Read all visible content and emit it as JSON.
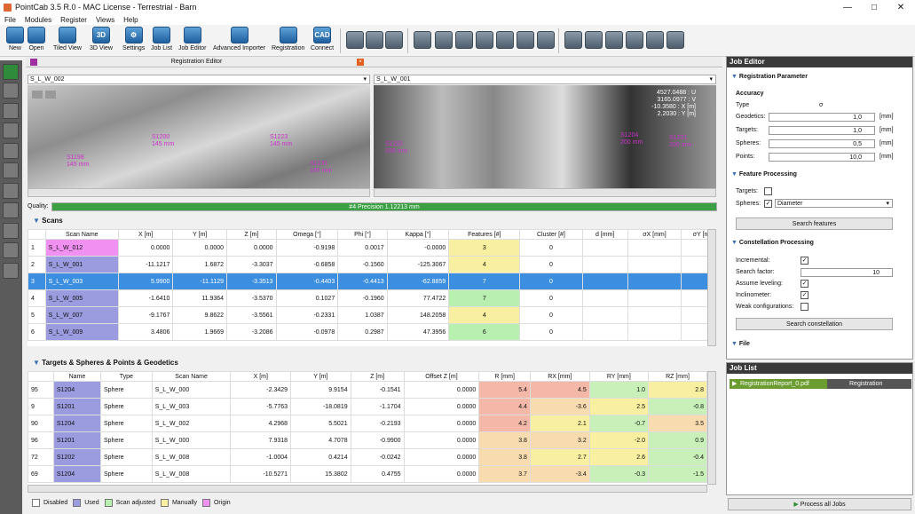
{
  "window": {
    "title": "PointCab 3.5 R.0 - MAC License - Terrestrial - Barn"
  },
  "menu": [
    "File",
    "Modules",
    "Register",
    "Views",
    "Help"
  ],
  "toolbar": {
    "buttons": [
      {
        "label": "New",
        "icon": "new-file-icon"
      },
      {
        "label": "Open",
        "icon": "open-folder-icon"
      },
      {
        "label": "Tiled View",
        "icon": "tiled-view-icon"
      },
      {
        "label": "3D View",
        "icon": "3d-view-icon",
        "text": "3D"
      },
      {
        "label": "Settings",
        "icon": "gear-icon"
      },
      {
        "label": "Job List",
        "icon": "job-list-icon"
      },
      {
        "label": "Job Editor",
        "icon": "job-editor-icon"
      },
      {
        "label": "Advanced Importer",
        "icon": "importer-icon"
      },
      {
        "label": "Registration",
        "icon": "registration-icon"
      },
      {
        "label": "Connect",
        "icon": "cad-connect-icon",
        "text": "CAD"
      }
    ]
  },
  "registration_editor": {
    "title": "Registration Editor",
    "left_view": {
      "scan": "S_L_W_002",
      "labels": [
        {
          "text": "S1198\n145 mm"
        },
        {
          "text": "S1200\n145 mm"
        },
        {
          "text": "S1223\n145 mm"
        },
        {
          "text": "S1231\n145 mm"
        }
      ]
    },
    "right_view": {
      "scan": "S_L_W_001",
      "labels": [
        {
          "text": "S1202\n200 mm"
        },
        {
          "text": "S1204\n200 mm"
        },
        {
          "text": "S1201\n200 mm"
        }
      ],
      "readout": [
        "4527.0488 : U",
        "3165.0977 : V",
        "-10.3580 : X [m]",
        "2.2030 : Y [m]",
        "200 mm"
      ]
    },
    "quality_label": "Quality:",
    "quality_text": "#4 Precision 1.12213 mm",
    "quality_fraction": 1.0
  },
  "scans": {
    "title": "Scans",
    "columns": [
      "",
      "Scan Name",
      "X [m]",
      "Y [m]",
      "Z [m]",
      "Omega [°]",
      "Phi [°]",
      "Kappa [°]",
      "Features [#]",
      "Cluster [#]",
      "d [mm]",
      "σX [mm]",
      "σY [n"
    ],
    "rows": [
      [
        "1",
        "S_L_W_012",
        "0.0000",
        "0.0000",
        "0.0000",
        "-0.9198",
        "0.0017",
        "-0.0000",
        "3",
        "0",
        "",
        "",
        ""
      ],
      [
        "2",
        "S_L_W_001",
        "-11.1217",
        "1.6872",
        "-3.3037",
        "-0.6858",
        "-0.1560",
        "-125.3067",
        "4",
        "0",
        "",
        "",
        ""
      ],
      [
        "3",
        "S_L_W_003",
        "5.9900",
        "-11.1129",
        "-3.3513",
        "-0.4403",
        "-0.4413",
        "-62.8859",
        "7",
        "0",
        "",
        "",
        ""
      ],
      [
        "4",
        "S_L_W_005",
        "-1.6410",
        "11.9364",
        "-3.5370",
        "0.1027",
        "-0.1960",
        "77.4722",
        "7",
        "0",
        "",
        "",
        ""
      ],
      [
        "5",
        "S_L_W_007",
        "-9.1767",
        "9.8622",
        "-3.5561",
        "-0.2331",
        "1.0387",
        "148.2058",
        "4",
        "0",
        "",
        "",
        ""
      ],
      [
        "6",
        "S_L_W_009",
        "3.4806",
        "1.9669",
        "-3.2086",
        "-0.0978",
        "0.2987",
        "47.3956",
        "6",
        "0",
        "",
        "",
        ""
      ]
    ],
    "selected_row": 2
  },
  "targets": {
    "title": "Targets & Spheres & Points & Geodetics",
    "columns": [
      "",
      "Name",
      "Type",
      "Scan Name",
      "X [m]",
      "Y [m]",
      "Z [m]",
      "Offset Z [m]",
      "R [mm]",
      "RX [mm]",
      "RY [mm]",
      "RZ [mm]"
    ],
    "rows": [
      [
        "95",
        "S1204",
        "Sphere",
        "S_L_W_000",
        "-2.3429",
        "9.9154",
        "-0.1541",
        "0.0000",
        "5.4",
        "4.5",
        "1.0",
        "2.8"
      ],
      [
        "9",
        "S1201",
        "Sphere",
        "S_L_W_003",
        "-5.7763",
        "-18.0819",
        "-1.1704",
        "0.0000",
        "4.4",
        "-3.6",
        "2.5",
        "-0.8"
      ],
      [
        "90",
        "S1204",
        "Sphere",
        "S_L_W_002",
        "4.2968",
        "5.5021",
        "-0.2193",
        "0.0000",
        "4.2",
        "2.1",
        "-0.7",
        "3.5"
      ],
      [
        "96",
        "S1201",
        "Sphere",
        "S_L_W_000",
        "7.9318",
        "4.7078",
        "-0.9900",
        "0.0000",
        "3.8",
        "3.2",
        "-2.0",
        "0.9"
      ],
      [
        "72",
        "S1202",
        "Sphere",
        "S_L_W_008",
        "-1.0004",
        "0.4214",
        "-0.0242",
        "0.0000",
        "3.8",
        "2.7",
        "2.6",
        "-0.4"
      ],
      [
        "69",
        "S1204",
        "Sphere",
        "S_L_W_008",
        "-10.5271",
        "15.3802",
        "0.4755",
        "0.0000",
        "3.7",
        "-3.4",
        "-0.3",
        "-1.5"
      ]
    ]
  },
  "legend": [
    {
      "label": "Disabled",
      "color": "#ffffff"
    },
    {
      "label": "Used",
      "color": "#9b9be0"
    },
    {
      "label": "Scan adjusted",
      "color": "#b8f0b0"
    },
    {
      "label": "Manually",
      "color": "#f8f0a0"
    },
    {
      "label": "Origin",
      "color": "#f090f0"
    }
  ],
  "job_editor": {
    "title": "Job Editor",
    "reg_param": "Registration Parameter",
    "accuracy": "Accuracy",
    "type_label": "Type",
    "type_value": "σ",
    "fields": [
      {
        "label": "Geodetics:",
        "value": "1,0",
        "unit": "[mm]"
      },
      {
        "label": "Targets:",
        "value": "1,0",
        "unit": "[mm]"
      },
      {
        "label": "Spheres:",
        "value": "0,5",
        "unit": "[mm]"
      },
      {
        "label": "Points:",
        "value": "10,0",
        "unit": "[mm]"
      }
    ],
    "feature_processing": "Feature Processing",
    "targets_label": "Targets:",
    "spheres_label": "Spheres:",
    "spheres_select": "Diameter",
    "search_features": "Search features",
    "constellation": "Constellation Processing",
    "incremental": "Incremental:",
    "search_factor": "Search factor:",
    "search_factor_value": "10",
    "assume_leveling": "Assume leveling:",
    "inclinometer": "Inclinometer:",
    "weak_config": "Weak configurations:",
    "search_constellation": "Search constellation",
    "file": "File"
  },
  "job_list": {
    "title": "Job List",
    "job": "RegistrationReport_0.pdf",
    "job_type": "Registration",
    "process_all": "Process all Jobs"
  }
}
